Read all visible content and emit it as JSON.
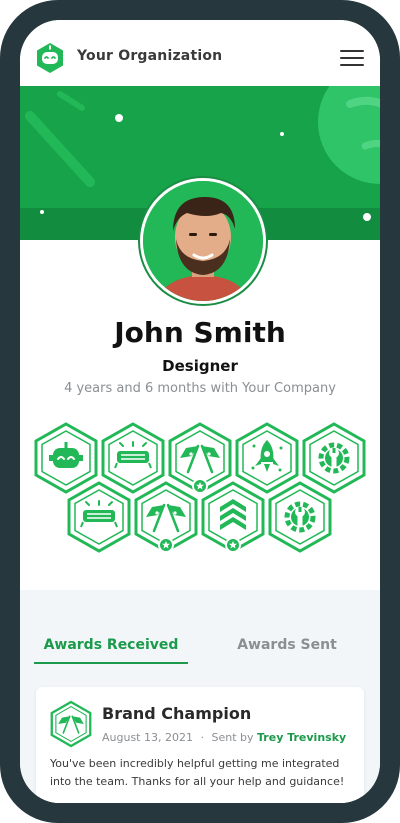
{
  "app": {
    "org_name": "Your Organization",
    "logo_icon": "robot-logo-icon",
    "menu_icon": "hamburger-icon"
  },
  "profile": {
    "name": "John Smith",
    "role": "Designer",
    "tenure": "4 years and 6 months with Your Company"
  },
  "badges": [
    "robot-badge-icon",
    "glasses-badge-icon",
    "flags-star-badge-icon",
    "rocket-badge-icon",
    "gear-wrench-badge-icon",
    "glasses-badge-icon",
    "flags-star-badge-icon",
    "chevrons-star-badge-icon",
    "gear-wrench-badge-icon"
  ],
  "tabs": {
    "received": "Awards Received",
    "sent": "Awards Sent"
  },
  "award": {
    "title": "Brand Champion",
    "date": "August 13, 2021",
    "separator": "·",
    "sent_by_label": "Sent by",
    "sender": "Trey Trevinsky",
    "message": "You've been incredibly helpful getting me integrated into the team. Thanks for all your help and guidance!"
  },
  "colors": {
    "brand_green": "#1a9a4a",
    "banner_green": "#17a34a",
    "frame": "#26383d"
  }
}
